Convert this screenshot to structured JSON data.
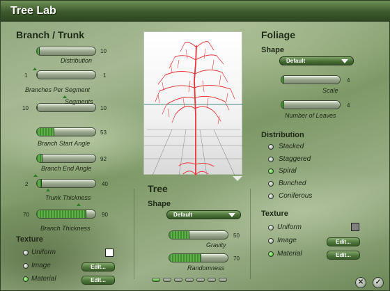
{
  "window": {
    "title": "Tree Lab"
  },
  "branch": {
    "heading": "Branch / Trunk",
    "sliders": [
      {
        "label": "Distribution",
        "left": "",
        "right": "10",
        "value": 0.05
      },
      {
        "label": "Branches Per Segment",
        "left": "1",
        "right": "1",
        "value": 0.0
      },
      {
        "label": "Segments",
        "left": "10",
        "right": "10",
        "value": 0.0
      },
      {
        "label": "Branch Start Angle",
        "left": "",
        "right": "53",
        "value": 0.3
      },
      {
        "label": "Branch End Angle",
        "left": "",
        "right": "92",
        "value": 0.1
      },
      {
        "label": "Trunk Thickness",
        "left": "2",
        "right": "40",
        "value": 0.08
      },
      {
        "label": "Branch Thickness",
        "left": "70",
        "right": "90",
        "value": 0.85
      }
    ],
    "texture": {
      "heading": "Texture",
      "options": [
        {
          "label": "Uniform",
          "selected": false
        },
        {
          "label": "Image",
          "selected": false
        },
        {
          "label": "Material",
          "selected": true
        }
      ],
      "uniform_color": "#ffffff",
      "edit_label": "Edit..."
    }
  },
  "tree": {
    "heading": "Tree",
    "shape_label": "Shape",
    "shape_value": "Default",
    "sliders": [
      {
        "label": "Gravity",
        "right": "50",
        "value": 0.35
      },
      {
        "label": "Randomness",
        "right": "70",
        "value": 0.55
      }
    ]
  },
  "foliage": {
    "heading": "Foliage",
    "shape_label": "Shape",
    "shape_value": "Default",
    "sliders": [
      {
        "label": "Scale",
        "right": "4",
        "value": 0.05
      },
      {
        "label": "Number of Leaves",
        "right": "4",
        "value": 0.05
      }
    ],
    "distribution": {
      "heading": "Distribution",
      "options": [
        {
          "label": "Stacked",
          "selected": false
        },
        {
          "label": "Staggered",
          "selected": false
        },
        {
          "label": "Spiral",
          "selected": true
        },
        {
          "label": "Bunched",
          "selected": false
        },
        {
          "label": "Coniferous",
          "selected": false
        }
      ]
    },
    "texture": {
      "heading": "Texture",
      "options": [
        {
          "label": "Uniform",
          "selected": false
        },
        {
          "label": "Image",
          "selected": false
        },
        {
          "label": "Material",
          "selected": true
        }
      ],
      "uniform_color": "#7f7f7f",
      "edit_label": "Edit..."
    }
  },
  "footer": {
    "pages": 7,
    "current_page": 0,
    "cancel_symbol": "✕",
    "ok_symbol": "✓"
  },
  "colors": {
    "accent_green": "#3f8c31",
    "tree_red": "#e8353a",
    "grid_teal": "#3e8f82"
  }
}
